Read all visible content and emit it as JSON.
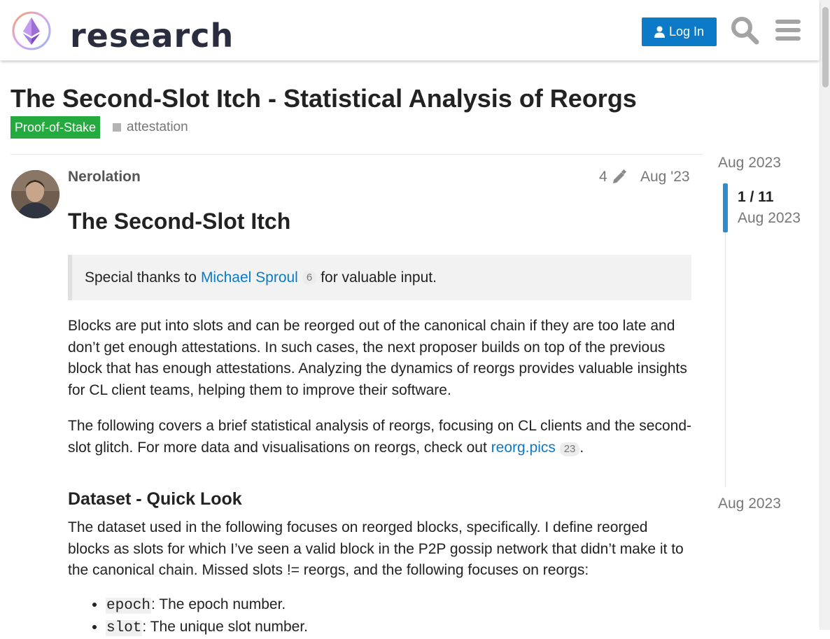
{
  "header": {
    "logo_text": "research",
    "login_label": "Log In"
  },
  "topic": {
    "title": "The Second-Slot Itch - Statistical Analysis of Reorgs",
    "category": "Proof-of-Stake",
    "category_color": "#25aa3f",
    "tag": "attestation"
  },
  "post": {
    "author": "Nerolation",
    "edit_count": "4",
    "date": "Aug '23",
    "heading": "The Second-Slot Itch",
    "quote_before": "Special thanks to",
    "quote_link": "Michael Sproul",
    "quote_link_count": "6",
    "quote_after": "for valuable input.",
    "para1": "Blocks are put into slots and can be reorged out of the canonical chain if they are too late and don’t get enough attestations. In such cases, the next proposer builds on top of the previous block that has enough attestations. Analyzing the dynamics of reorgs provides valuable insights for CL client teams, helping them to improve their software.",
    "para2_before": "The following covers a brief statistical analysis of reorgs, focusing on CL clients and the second-slot glitch. For more data and visualisations on reorgs, check out",
    "para2_link": "reorg.pics",
    "para2_link_count": "23",
    "para2_after": ".",
    "section_heading": "Dataset - Quick Look",
    "para3": "The dataset used in the following focuses on reorged blocks, specifically. I define reorged blocks as slots for which I’ve seen a valid block in the P2P gossip network that didn’t make it to the canonical chain. Missed slots != reorgs, and the following focuses on reorgs:",
    "fields": [
      {
        "code": "epoch",
        "desc": ": The epoch number."
      },
      {
        "code": "slot",
        "desc": ": The unique slot number."
      }
    ]
  },
  "timeline": {
    "start_date": "Aug 2023",
    "position": "1 / 11",
    "position_date": "Aug 2023",
    "end_date": "Aug 2023"
  },
  "colors": {
    "accent": "#0c7ac7",
    "category": "#25aa3f"
  }
}
